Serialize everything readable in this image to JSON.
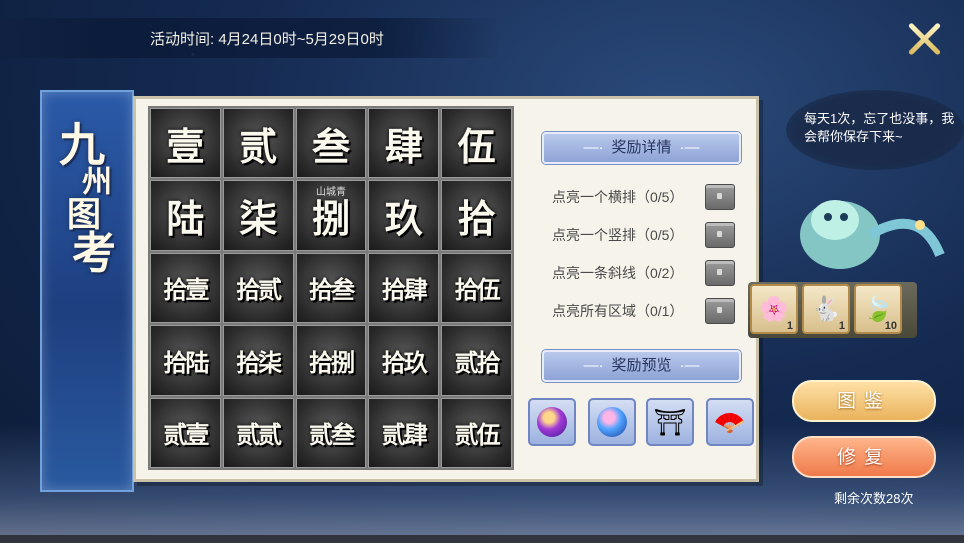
{
  "event": {
    "time_text": "活动时间: 4月24日0时~5月29日0时"
  },
  "title": {
    "chars": [
      "九",
      "州",
      "图",
      "考"
    ]
  },
  "grid": {
    "cells": [
      "壹",
      "贰",
      "叁",
      "肆",
      "伍",
      "陆",
      "柒",
      "捌",
      "玖",
      "拾",
      "拾壹",
      "拾贰",
      "拾叁",
      "拾肆",
      "拾伍",
      "拾陆",
      "拾柒",
      "拾捌",
      "拾玖",
      "贰拾",
      "贰壹",
      "贰贰",
      "贰叁",
      "贰肆",
      "贰伍"
    ],
    "inline_tag": "山城青"
  },
  "rewards": {
    "details_title": "奖励详情",
    "items": [
      {
        "label": "点亮一个横排（0/5）"
      },
      {
        "label": "点亮一个竖排（0/5）"
      },
      {
        "label": "点亮一条斜线（0/2）"
      },
      {
        "label": "点亮所有区域（0/1）"
      }
    ],
    "preview_title": "奖励预览",
    "preview_icons": [
      "purple-orb-icon",
      "blue-orb-icon",
      "pavilion-icon",
      "fan-icon"
    ]
  },
  "side_items": [
    {
      "icon": "flower-icon",
      "count": "1"
    },
    {
      "icon": "rabbit-icon",
      "count": "1"
    },
    {
      "icon": "leaf-icon",
      "count": "10"
    }
  ],
  "npc": {
    "speech": "每天1次，忘了也没事，我会帮你保存下来~"
  },
  "buttons": {
    "atlas": "图鉴",
    "repair": "修复"
  },
  "remaining_text": "剩余次数28次"
}
